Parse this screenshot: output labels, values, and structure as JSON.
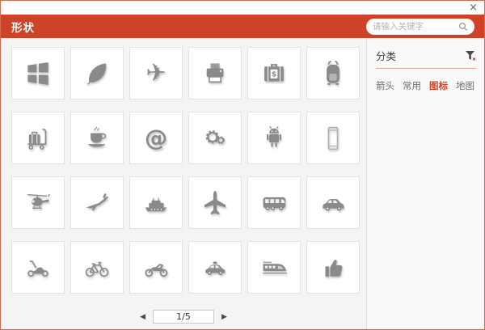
{
  "window": {
    "close_label": "×"
  },
  "header": {
    "title": "形状",
    "search_placeholder": "请输入关键字"
  },
  "sidebar": {
    "heading": "分类",
    "categories": [
      {
        "label": "箭头",
        "active": false
      },
      {
        "label": "常用",
        "active": false
      },
      {
        "label": "图标",
        "active": true
      },
      {
        "label": "地图",
        "active": false
      }
    ]
  },
  "grid": {
    "icons": [
      "windows-logo",
      "leaf",
      "airplane",
      "printer",
      "briefcase-dollar",
      "backpack",
      "luggage-cart",
      "coffee-cup",
      "at-symbol",
      "gears",
      "android-robot",
      "smartphone",
      "helicopter",
      "private-jet",
      "cruise-ship",
      "airplane-top-view",
      "bus",
      "suv-car",
      "scooter",
      "bicycle",
      "motorcycle",
      "taxi",
      "high-speed-train",
      "thumbs-up"
    ]
  },
  "glyphs": {
    "airplane": "✈",
    "at": "@"
  },
  "pagination": {
    "current": "1/5",
    "prev": "◀",
    "next": "▶"
  },
  "colors": {
    "accent": "#ce4227",
    "icon_gray": "#8a8a8a"
  }
}
